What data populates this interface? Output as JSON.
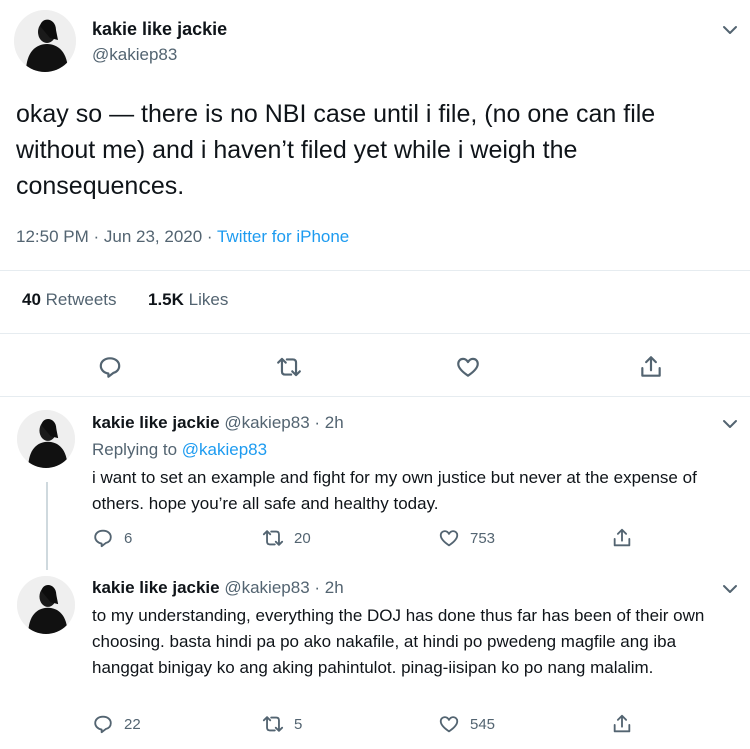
{
  "main_tweet": {
    "display_name": "kakie like jackie",
    "handle": "@kakiep83",
    "text": "okay so — there is no NBI case until i file, (no one can file without me) and i haven’t filed yet while i weigh the consequences.",
    "time": "12:50 PM · Jun 23, 2020 · ",
    "source": "Twitter for iPhone",
    "retweets_count": "40",
    "retweets_label": "Retweets",
    "likes_count": "1.5K",
    "likes_label": "Likes",
    "icons": [
      "reply-icon",
      "retweet-icon",
      "like-icon",
      "share-icon"
    ]
  },
  "replies": [
    {
      "display_name": "kakie like jackie",
      "handle_time": "@kakiep83 · 2h",
      "replying_prefix": "Replying to ",
      "replying_to": "@kakiep83",
      "text": "i want to set an example and fight for my own justice but never at the expense of others. hope you’re all safe and healthy today.",
      "reply_count": "6",
      "retweet_count": "20",
      "like_count": "753"
    },
    {
      "display_name": "kakie like jackie",
      "handle_time": "@kakiep83 · 2h",
      "text": "to my understanding, everything the DOJ has done thus far has been of their own choosing. basta hindi pa po ako nakafile, at hindi po pwedeng magfile ang iba hanggat binigay ko ang aking pahintulot. pinag-iisipan ko po nang malalim.",
      "reply_count": "22",
      "retweet_count": "5",
      "like_count": "545"
    }
  ],
  "colors": {
    "accent": "#1d9bf0",
    "muted": "#536471",
    "text": "#0f1419",
    "divider": "#e6ecf0"
  }
}
